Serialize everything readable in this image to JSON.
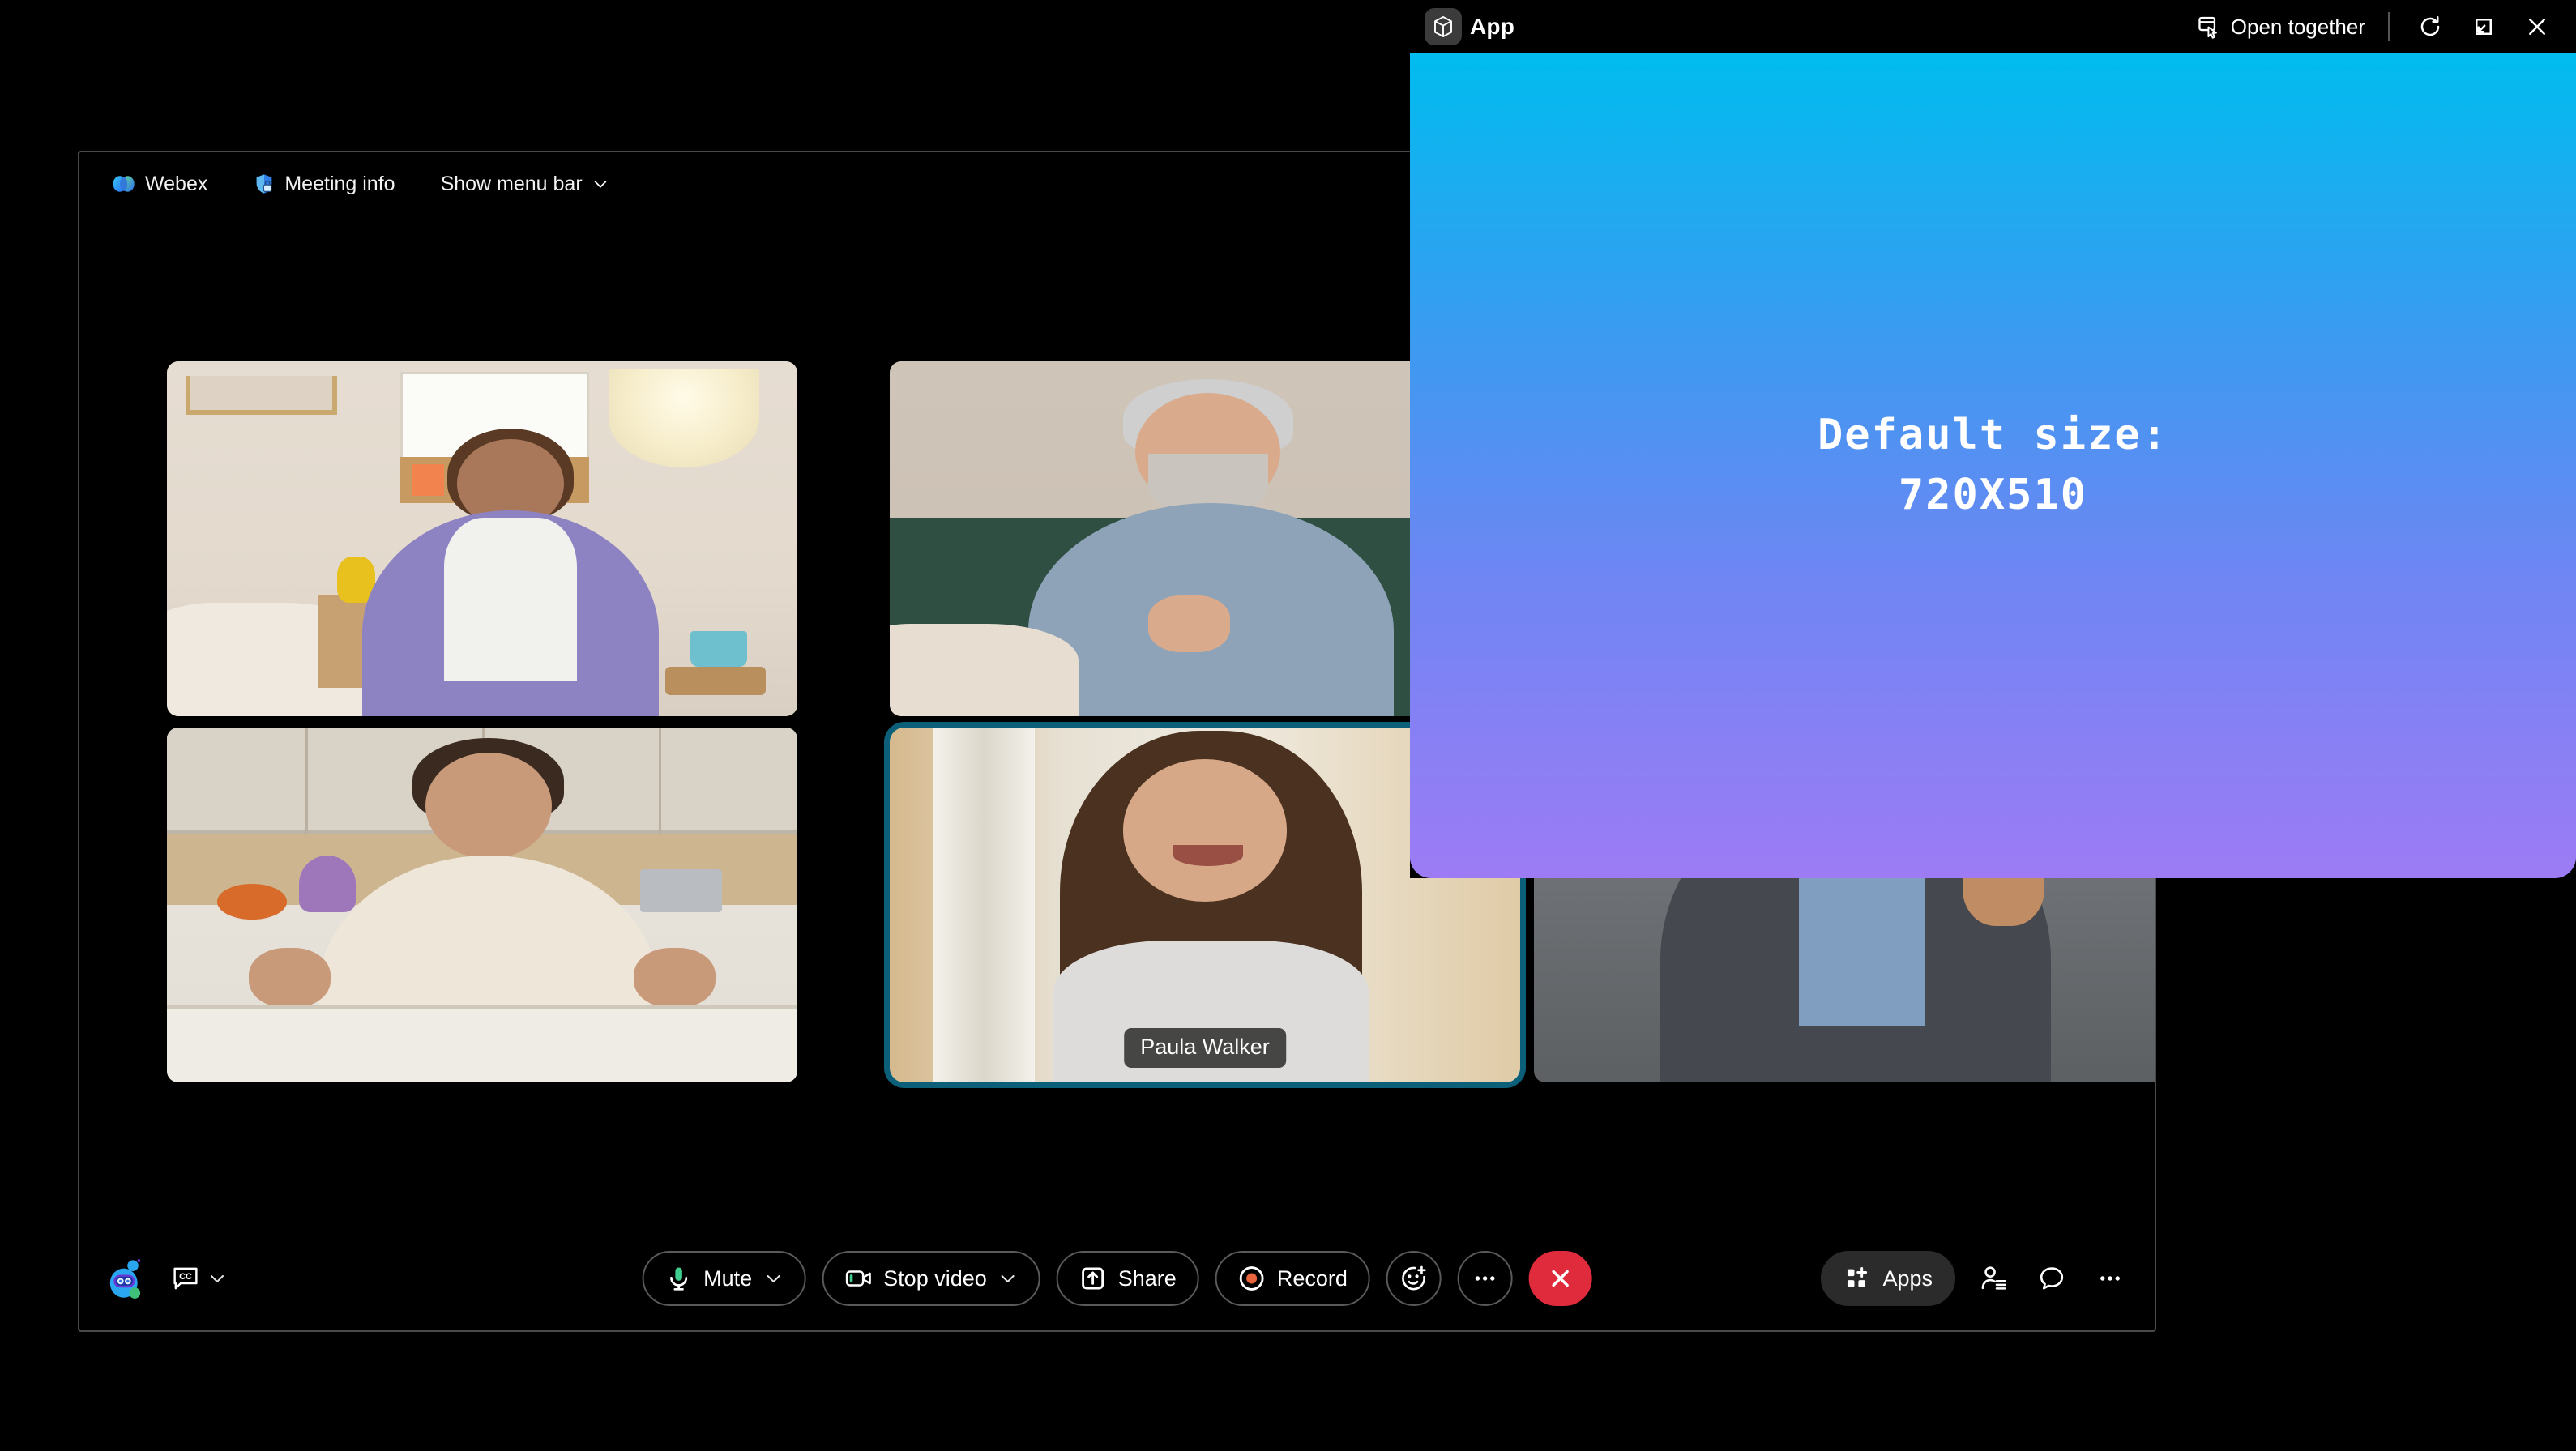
{
  "webex": {
    "menubar": {
      "brand": "Webex",
      "brand_icon": "webex-logo-icon",
      "meeting_info": "Meeting info",
      "meeting_info_icon": "shield-lock-icon",
      "show_menu_bar": "Show menu bar",
      "show_menu_bar_chevron": "chevron-down-icon"
    },
    "participants": [
      {
        "name": "",
        "active": false,
        "scene": "bedroom-purple-shirt"
      },
      {
        "name": "",
        "active": false,
        "scene": "green-sofa-older-man"
      },
      {
        "name": "",
        "active": false,
        "scene": "kitchen-cream-blouse"
      },
      {
        "name": "Paula Walker",
        "active": true,
        "scene": "long-hair-warm-room"
      },
      {
        "name": "",
        "active": false,
        "scene": "city-window-suit"
      }
    ],
    "active_speaker_name": "Paula Walker",
    "toolbar": {
      "assistant_icon": "ai-assistant-icon",
      "closed_captions_icon": "cc-icon",
      "closed_captions_chevron": "chevron-down-icon",
      "mute_label": "Mute",
      "mute_icon": "microphone-icon",
      "mute_chevron": "chevron-down-icon",
      "stop_video_label": "Stop video",
      "stop_video_icon": "camera-icon",
      "stop_video_chevron": "chevron-down-icon",
      "share_label": "Share",
      "share_icon": "share-up-icon",
      "record_label": "Record",
      "record_icon": "record-dot-icon",
      "reactions_icon": "smiley-plus-icon",
      "more_icon": "ellipsis-icon",
      "leave_icon": "close-x-icon",
      "apps_label": "Apps",
      "apps_icon": "apps-grid-plus-icon",
      "participants_icon": "participants-list-icon",
      "chat_icon": "chat-bubble-icon",
      "panel_more_icon": "ellipsis-icon"
    }
  },
  "app_panel": {
    "title": "App",
    "app_icon": "cube-app-icon",
    "open_together_label": "Open together",
    "open_together_icon": "open-together-cursor-icon",
    "refresh_icon": "refresh-icon",
    "restore_icon": "restore-down-icon",
    "close_icon": "close-x-icon",
    "message": "Default size:\n720X510",
    "gradient_top": "#00BCEF",
    "gradient_bottom": "#9D7BF5"
  },
  "colors": {
    "accent_cyan": "#00B6E4",
    "danger_red": "#e02b3c",
    "record_orange": "#e8643c",
    "mic_green": "#3ecf8e"
  }
}
